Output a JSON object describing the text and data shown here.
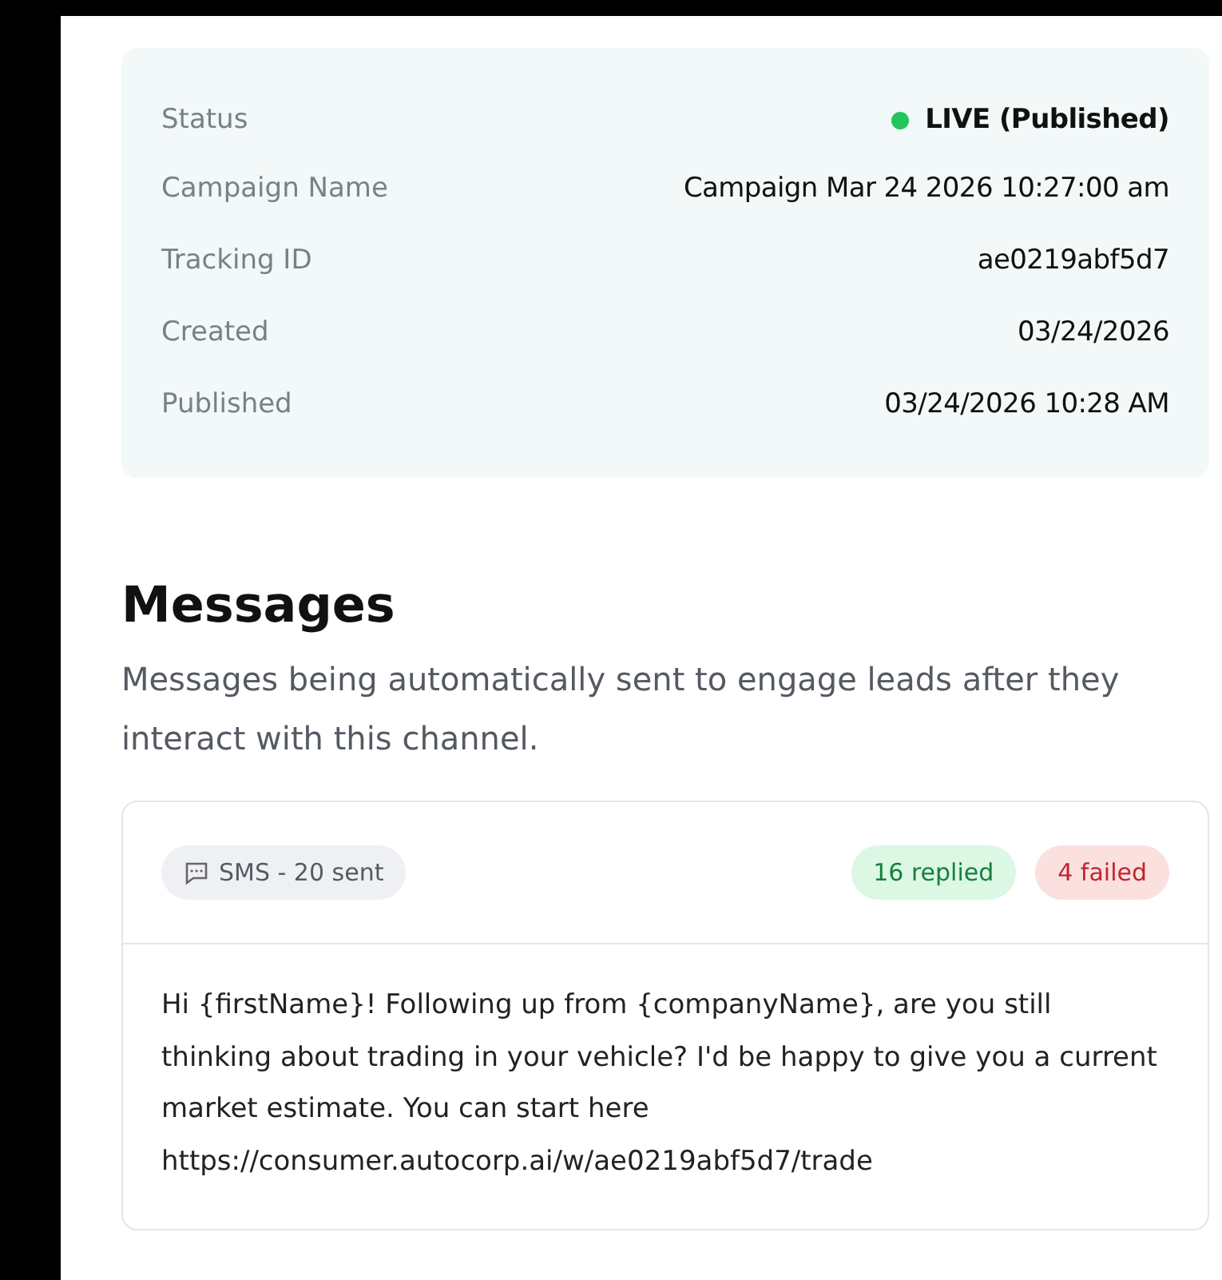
{
  "details": [
    {
      "label": "Status",
      "value": "LIVE (Published)",
      "kind": "status",
      "color": "#22c55e"
    },
    {
      "label": "Campaign Name",
      "value": "Campaign Mar 24 2026 10:27:00 am",
      "kind": "text"
    },
    {
      "label": "Tracking ID",
      "value": "ae0219abf5d7",
      "kind": "text"
    },
    {
      "label": "Created",
      "value": "03/24/2026",
      "kind": "text"
    },
    {
      "label": "Published",
      "value": "03/24/2026 10:28 AM",
      "kind": "text"
    }
  ],
  "messages": {
    "title": "Messages",
    "description": "Messages being automatically sent to engage leads after they interact with this channel.",
    "items": [
      {
        "channel": "SMS - 20 sent",
        "replied": "16 replied",
        "failed": "4 failed",
        "body": "Hi {firstName}! Following up from {companyName}, are you still thinking about trading in your vehicle? I'd be happy to give you a current market estimate. You can start here https://consumer.autocorp.ai/w/ae0219abf5d7/trade"
      }
    ]
  }
}
